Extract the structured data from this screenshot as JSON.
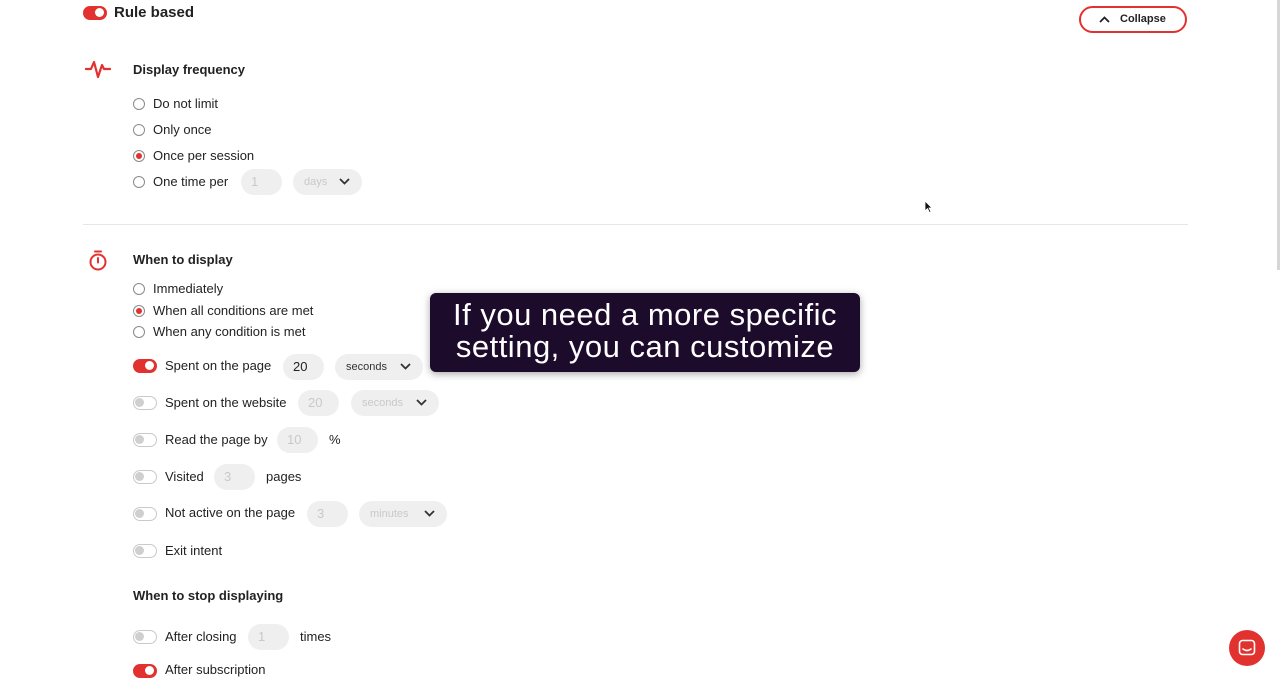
{
  "header": {
    "toggle_label": "Rule based",
    "toggle_on": true,
    "collapse_label": "Collapse"
  },
  "display_frequency": {
    "title": "Display frequency",
    "icon": "pulse-icon",
    "options": [
      "Do not limit",
      "Only once",
      "Once per session",
      "One time per"
    ],
    "selected": "Once per session",
    "one_time_per_value": "1",
    "one_time_per_unit": "days"
  },
  "when_to_display": {
    "title": "When to display",
    "icon": "timer-icon",
    "options": [
      "Immediately",
      "When all conditions are met",
      "When any condition is met"
    ],
    "selected": "When all conditions are met",
    "conditions": {
      "spent_page": {
        "label": "Spent on the page",
        "on": true,
        "value": "20",
        "unit": "seconds"
      },
      "spent_website": {
        "label": "Spent on the website",
        "on": false,
        "value": "20",
        "unit": "seconds"
      },
      "read_page": {
        "label": "Read the page by",
        "on": false,
        "value": "10",
        "suffix": "%"
      },
      "visited": {
        "label": "Visited",
        "on": false,
        "value": "3",
        "suffix": "pages"
      },
      "not_active": {
        "label": "Not active on the page",
        "on": false,
        "value": "3",
        "unit": "minutes"
      },
      "exit_intent": {
        "label": "Exit intent",
        "on": false
      }
    }
  },
  "when_to_stop": {
    "title": "When to stop displaying",
    "after_closing": {
      "label": "After closing",
      "on": false,
      "value": "1",
      "suffix": "times"
    },
    "after_subscription": {
      "label": "After subscription",
      "on": true
    }
  },
  "tooltip": {
    "line1": "If you need a more specific",
    "line2": "setting, you can customize"
  },
  "colors": {
    "accent": "#e2322f",
    "tooltip_bg": "#1c0b2b"
  }
}
